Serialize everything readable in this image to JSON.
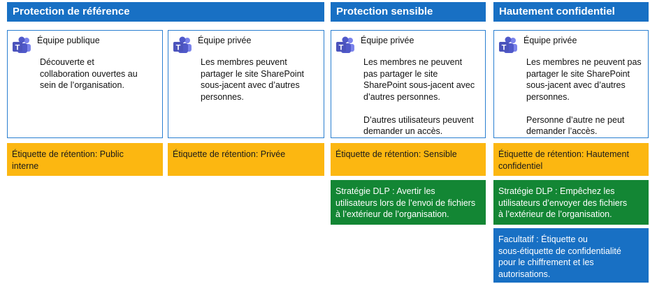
{
  "headers": [
    "Protection de référence",
    "Protection sensible",
    "Hautement confidentiel"
  ],
  "cards": [
    {
      "title": "Équipe publique",
      "desc": "Découverte et\ncollaboration ouvertes au\nsein de l’organisation."
    },
    {
      "title": "Équipe privée",
      "desc": "Les membres peuvent\npartager le site SharePoint\nsous-jacent avec d’autres\npersonnes."
    },
    {
      "title": "Équipe privée",
      "desc": "Les membres ne peuvent\npas partager le site\nSharePoint sous-jacent avec\nd’autres personnes.\n\nD’autres utilisateurs peuvent\ndemander un accès."
    },
    {
      "title": "Équipe privée",
      "desc": "Les membres ne peuvent pas\npartager le site SharePoint\nsous-jacent avec d’autres\npersonnes.\n\nPersonne d’autre ne peut\ndemander l’accès."
    }
  ],
  "retention": [
    "Étiquette de rétention: Public\ninterne",
    "Étiquette de rétention: Privée",
    "Étiquette de rétention: Sensible",
    "Étiquette de rétention: Hautement\nconfidentiel"
  ],
  "dlp": [
    "Stratégie DLP : Avertir les\nutilisateurs lors de l’envoi de fichiers\nà l’extérieur de l’organisation.",
    "Stratégie DLP : Empêchez les\nutilisateurs d’envoyer des fichiers\nà l’extérieur de l’organisation."
  ],
  "optional": "Facultatif : Étiquette ou\nsous-étiquette de confidentialité\npour le chiffrement et les\nautorisations.",
  "colors": {
    "header_blue": "#1870c4",
    "retention_yellow": "#fcb711",
    "dlp_green": "#138634",
    "teams_purple": "#5059c9"
  },
  "icon": "microsoft-teams-icon"
}
